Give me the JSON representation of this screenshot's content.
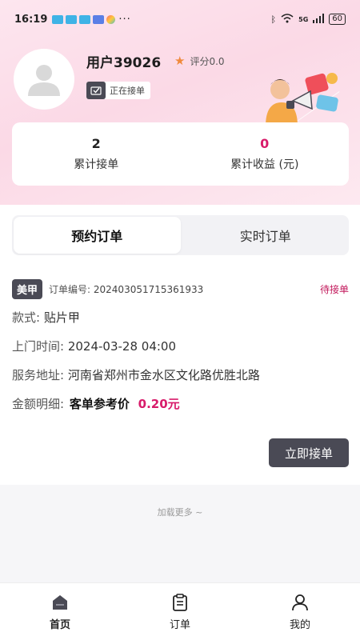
{
  "status_bar": {
    "time": "16:19",
    "more": "···",
    "network": "5G",
    "battery": "60"
  },
  "profile": {
    "username": "用户39026",
    "rating_label": "评分0.0",
    "status_tag": "正在接单"
  },
  "stats": [
    {
      "value": "2",
      "label": "累计接单"
    },
    {
      "value": "0",
      "label": "累计收益 (元)"
    }
  ],
  "tabs": [
    {
      "label": "预约订单",
      "active": true
    },
    {
      "label": "实时订单",
      "active": false
    }
  ],
  "order": {
    "category": "美甲",
    "number_label": "订单编号:",
    "number": "20240305171536193​3",
    "state": "待接单",
    "style_label": "款式:",
    "style_value": "贴片甲",
    "time_label": "上门时间:",
    "time_value": "2024-03-28 04:00",
    "address_label": "服务地址:",
    "address_value": "河南省郑州市金水区文化路优胜北路",
    "amount_label": "金额明细:",
    "amount_desc": "客单参考价",
    "amount_value": "0.20元",
    "accept_button": "立即接单"
  },
  "load_more": "加载更多 ~",
  "nav": [
    {
      "label": "首页",
      "icon": "home-icon",
      "active": true
    },
    {
      "label": "订单",
      "icon": "clipboard-icon",
      "active": false
    },
    {
      "label": "我的",
      "icon": "user-icon",
      "active": false
    }
  ],
  "colors": {
    "accent": "#d81b6a",
    "dark": "#4a4a55",
    "header_bg": "#fbd9e6"
  }
}
